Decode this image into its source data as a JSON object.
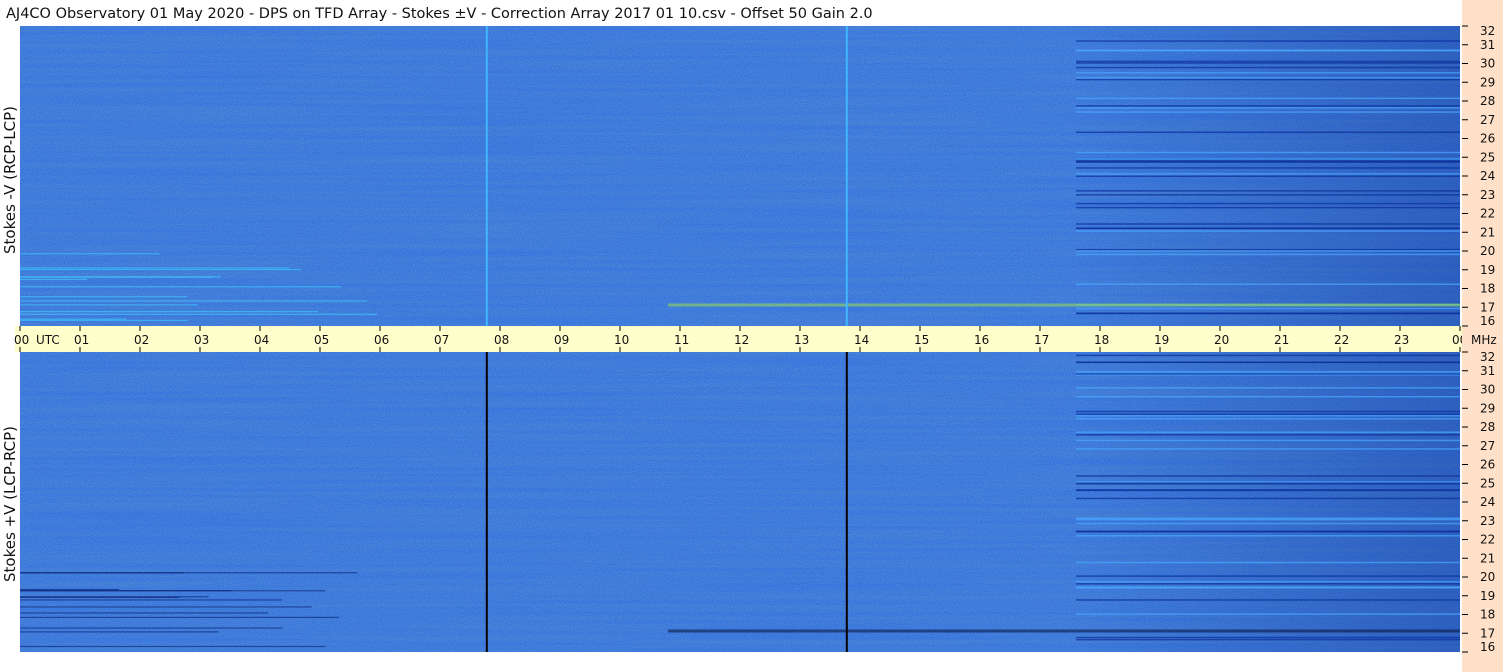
{
  "app": {
    "title": "AJ4CO Observatory  01 May 2020  -  DPS on TFD Array  -  Stokes ±V  -  Correction Array 2017 01 10.csv  -  Offset 50  Gain 2.0"
  },
  "colors": {
    "page_bg": "#ffffff",
    "time_band": "#ffffcc",
    "freq_band": "#ffe0c8",
    "spectrogram_base": "#1a5fd8",
    "tick": "#000000"
  },
  "chart_data": [
    {
      "type": "heatmap",
      "panel": "top",
      "ylabel": "Stokes -V (RCP-LCP)",
      "y_unit": "MHz",
      "y_ticks": [
        32,
        31,
        30,
        29,
        28,
        27,
        26,
        25,
        24,
        23,
        22,
        21,
        20,
        19,
        18,
        17,
        16
      ],
      "ylim": [
        16,
        32
      ],
      "x_ticks": [
        "00",
        "01",
        "02",
        "03",
        "04",
        "05",
        "06",
        "07",
        "08",
        "09",
        "10",
        "11",
        "12",
        "13",
        "14",
        "15",
        "16",
        "17",
        "18",
        "19",
        "20",
        "21",
        "22",
        "23",
        "00"
      ],
      "xlim_hours": [
        0,
        24
      ],
      "vertical_lines": [
        {
          "x_hours": 7.78,
          "color": "#3fb6ff"
        },
        {
          "x_hours": 13.78,
          "color": "#3fb6ff"
        }
      ]
    },
    {
      "type": "heatmap",
      "panel": "bottom",
      "ylabel": "Stokes +V (LCP-RCP)",
      "y_unit": "MHz",
      "y_ticks": [
        32,
        31,
        30,
        29,
        28,
        27,
        26,
        25,
        24,
        23,
        22,
        21,
        20,
        19,
        18,
        17,
        16
      ],
      "ylim": [
        16,
        32
      ],
      "x_ticks": [
        "00",
        "01",
        "02",
        "03",
        "04",
        "05",
        "06",
        "07",
        "08",
        "09",
        "10",
        "11",
        "12",
        "13",
        "14",
        "15",
        "16",
        "17",
        "18",
        "19",
        "20",
        "21",
        "22",
        "23",
        "00"
      ],
      "xlim_hours": [
        0,
        24
      ],
      "vertical_lines": [
        {
          "x_hours": 7.78,
          "color": "#000000"
        },
        {
          "x_hours": 13.78,
          "color": "#000000"
        }
      ]
    }
  ],
  "time_axis": {
    "utc_label": "UTC",
    "mhz_label": "MHz"
  }
}
